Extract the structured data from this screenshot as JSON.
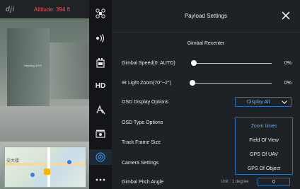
{
  "header": {
    "brand": "dji",
    "altitude": "Altitude: 394 ft"
  },
  "camera_view": {
    "overlay_text": "Heading 4375"
  },
  "map": {
    "label": "交大楼"
  },
  "icon_bar": {
    "items": [
      {
        "name": "drone-icon"
      },
      {
        "name": "signal-icon"
      },
      {
        "name": "payload-icon"
      },
      {
        "name": "hd-icon",
        "label": "HD"
      },
      {
        "name": "text-recognition-icon"
      },
      {
        "name": "camera-icon"
      },
      {
        "name": "target-icon"
      },
      {
        "name": "more-icon",
        "label": "..."
      }
    ]
  },
  "panel": {
    "title": "Payload Settings",
    "section": "Gimbal Recenter",
    "rows": {
      "gimbal_speed": {
        "label": "Gimbal Speed(0: AUTO)",
        "value": "0%",
        "level": 0.0
      },
      "ir_zoom": {
        "label": "IR Light Zoom(70°~2°)",
        "value": "0%",
        "level": 0.0
      },
      "osd_display": {
        "label": "OSD Display Options"
      },
      "osd_type": {
        "label": "OSD Type Options"
      },
      "track_frame": {
        "label": "Track Frame Size"
      },
      "camera_settings": {
        "label": "Camera Settings"
      },
      "pitch_angle": {
        "label": "Gimbal Pitch Angle",
        "unit": "Unit : 1 degree",
        "value": "0"
      }
    },
    "osd_dropdown": {
      "selected": "Display All",
      "options": [
        "Zoom times",
        "Field Of View",
        "GPS Of UAV",
        "GPS Of Object"
      ],
      "active_index": 0
    }
  },
  "colors": {
    "accent": "#2a6fb2",
    "accent_text": "#6fa9e6",
    "panel_bg": "#1e2125",
    "warning": "#ff4d57"
  }
}
